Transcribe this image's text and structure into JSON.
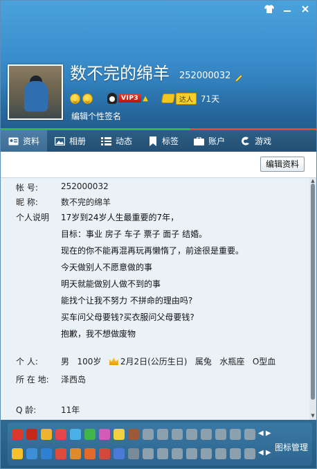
{
  "window": {
    "controls": [
      "shirt-icon",
      "minimize-icon",
      "close-icon"
    ],
    "accent": "#3a8dcb"
  },
  "profile": {
    "nickname": "数不完的绵羊",
    "qq_number": "252000032",
    "vip_label": "VIP3",
    "daren_label": "达人",
    "active_days": "71天",
    "signature_hint": "编辑个性签名"
  },
  "tabs": [
    {
      "label": "资料",
      "icon": "id-card-icon",
      "active": true
    },
    {
      "label": "相册",
      "icon": "photo-icon"
    },
    {
      "label": "动态",
      "icon": "list-icon"
    },
    {
      "label": "标签",
      "icon": "bookmark-icon"
    },
    {
      "label": "账户",
      "icon": "wallet-icon"
    },
    {
      "label": "游戏",
      "icon": "game-icon"
    }
  ],
  "toolbar": {
    "edit_label": "编辑资料"
  },
  "info": {
    "account_label": "帐    号:",
    "account_value": "252000032",
    "nick_label": "昵    称:",
    "nick_value": "数不完的绵羊",
    "desc_label": "个人说明",
    "desc_lines": [
      "17岁到24岁人生最重要的7年，",
      "目标：事业 房子 车子 票子 面子 结婚。",
      "现在的你不能再混再玩再懒惰了，前途很是重要。",
      "今天做别人不愿意做的事",
      "明天就能做别人做不到的事",
      "能找个让我不努力 不拼命的理由吗?",
      "买车问父母要钱?买衣服问父母要钱?",
      "抱歉，我不想做废物"
    ],
    "person_label": "个    人:",
    "gender": "男",
    "age": "100岁",
    "birthday": "2月2日(公历生日)",
    "zodiac": "属兔",
    "constellation": "水瓶座",
    "blood": "O型血",
    "location_label": "所 在 地:",
    "location_value": "泽西岛",
    "qage_label": "Q     龄:",
    "qage_value": "11年"
  },
  "bottom": {
    "icon_manage": "图标管理"
  }
}
